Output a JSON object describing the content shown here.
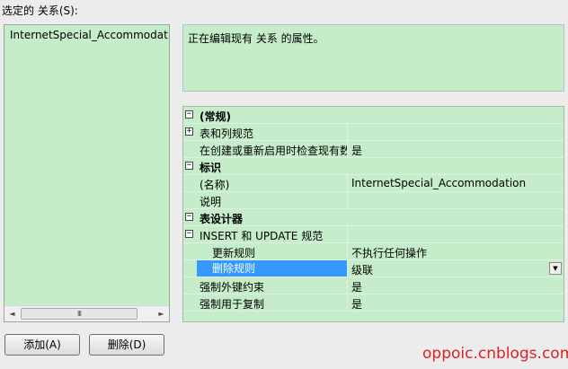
{
  "left": {
    "label": "选定的 关系(S):",
    "items": [
      "InternetSpecial_Accommodatio"
    ],
    "scrollbar": {
      "left": "◄",
      "thumb": "III",
      "right": "►"
    }
  },
  "description": "正在编辑现有 关系 的属性。",
  "grid": {
    "rows": [
      {
        "toggle": "−",
        "name": "(常规)",
        "value": "",
        "type": "category"
      },
      {
        "toggle": "+",
        "name": "表和列规范",
        "value": "",
        "type": "prop"
      },
      {
        "toggle": "",
        "name": "在创建或重新启用时检查现有数",
        "value": "是",
        "type": "prop"
      },
      {
        "toggle": "−",
        "name": "标识",
        "value": "",
        "type": "category"
      },
      {
        "toggle": "",
        "name": "(名称)",
        "value": "InternetSpecial_Accommodation",
        "type": "prop"
      },
      {
        "toggle": "",
        "name": "说明",
        "value": "",
        "type": "prop"
      },
      {
        "toggle": "−",
        "name": "表设计器",
        "value": "",
        "type": "category"
      },
      {
        "toggle": "−",
        "name": "INSERT 和 UPDATE 规范",
        "value": "",
        "type": "prop"
      },
      {
        "toggle": "",
        "name": "更新规则",
        "value": "不执行任何操作",
        "type": "sub"
      },
      {
        "toggle": "",
        "name": "删除规则",
        "value": "级联",
        "type": "sub-selected"
      },
      {
        "toggle": "",
        "name": "强制外键约束",
        "value": "是",
        "type": "prop"
      },
      {
        "toggle": "",
        "name": "强制用于复制",
        "value": "是",
        "type": "prop"
      }
    ],
    "dropdown_glyph": "▼"
  },
  "buttons": {
    "add": "添加(A)",
    "delete": "删除(D)"
  },
  "watermark": "oppoic.cnblogs.com",
  "colors": {
    "panel_green": "#c6edca",
    "selection": "#3399ff",
    "watermark": "#e02020"
  }
}
